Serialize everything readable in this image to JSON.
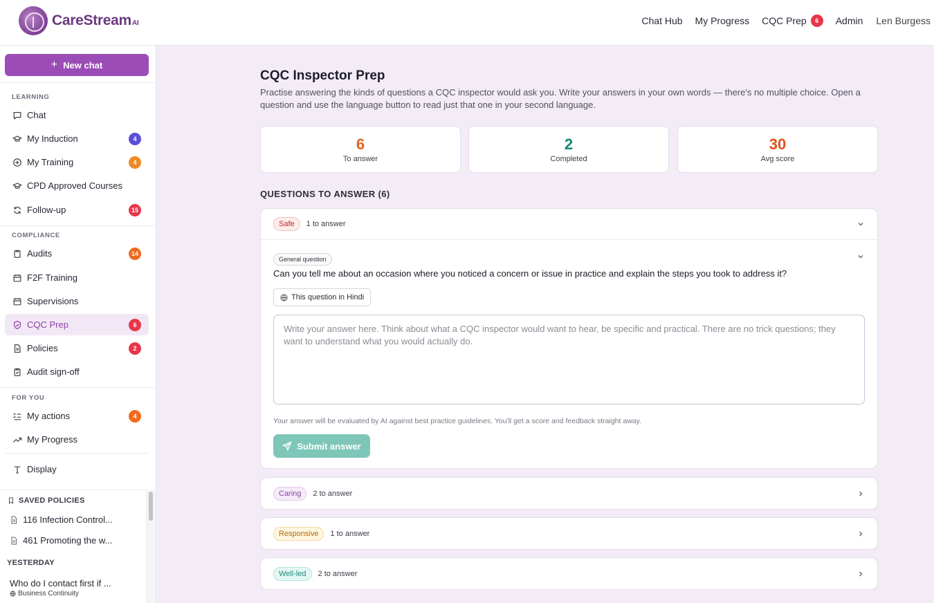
{
  "app": {
    "brand": "CareStream",
    "brand_suffix": "AI"
  },
  "topnav": {
    "items": [
      {
        "label": "Chat Hub"
      },
      {
        "label": "My Progress"
      },
      {
        "label": "CQC Prep",
        "badge": "6"
      },
      {
        "label": "Admin"
      }
    ],
    "user": "Len Burgess"
  },
  "sidebar": {
    "new_chat_label": "New chat",
    "sections": {
      "learning": "LEARNING",
      "compliance": "COMPLIANCE",
      "for_you": "FOR YOU"
    },
    "items": [
      {
        "label": "Chat",
        "icon": "chat-icon"
      },
      {
        "label": "My Induction",
        "icon": "graduation-cap-icon",
        "badge": "4"
      },
      {
        "label": "My Training",
        "icon": "training-icon",
        "badge": "4"
      },
      {
        "label": "CPD Approved Courses",
        "icon": "graduation-cap-icon"
      },
      {
        "label": "Follow-up",
        "icon": "refresh-icon",
        "badge": "15"
      },
      {
        "label": "Audits",
        "icon": "clipboard-icon",
        "badge": "14"
      },
      {
        "label": "F2F Training",
        "icon": "calendar-icon"
      },
      {
        "label": "Supervisions",
        "icon": "calendar-icon"
      },
      {
        "label": "CQC Prep",
        "icon": "shield-check-icon",
        "badge": "6",
        "active": true
      },
      {
        "label": "Policies",
        "icon": "document-icon",
        "badge": "2"
      },
      {
        "label": "Audit sign-off",
        "icon": "clipboard-check-icon"
      },
      {
        "label": "My actions",
        "icon": "checklist-icon",
        "badge": "4"
      },
      {
        "label": "My Progress",
        "icon": "trending-up-icon"
      },
      {
        "label": "Display",
        "icon": "text-type-icon"
      }
    ],
    "saved_label": "SAVED POLICIES",
    "saved": [
      {
        "label": "116 Infection Control..."
      },
      {
        "label": "461 Promoting the w..."
      }
    ],
    "yesterday_label": "YESTERDAY",
    "history": [
      {
        "title": "Who do I contact first if ...",
        "sub": "Business Continuity"
      }
    ]
  },
  "main": {
    "title": "CQC Inspector Prep",
    "description": "Practise answering the kinds of questions a CQC inspector would ask you. Write your answers in your own words — there's no multiple choice. Open a question and use the language button to read just that one in your second language.",
    "stats": [
      {
        "value": "6",
        "label": "To answer",
        "color": "#e0631b"
      },
      {
        "value": "2",
        "label": "Completed",
        "color": "#118a74"
      },
      {
        "value": "30",
        "label": "Avg score",
        "color": "#e0521b"
      }
    ],
    "questions_heading": "QUESTIONS TO ANSWER (6)",
    "categories": [
      {
        "name": "Safe",
        "count": "1 to answer",
        "expanded": true
      },
      {
        "name": "Caring",
        "count": "2 to answer"
      },
      {
        "name": "Responsive",
        "count": "1 to answer"
      },
      {
        "name": "Well-led",
        "count": "2 to answer"
      }
    ],
    "open_question": {
      "tag": "General question",
      "text": "Can you tell me about an occasion where you noticed a concern or issue in practice and explain the steps you took to address it?",
      "language_button": "This question in Hindi",
      "answer_placeholder": "Write your answer here. Think about what a CQC inspector would want to hear, be specific and practical. There are no trick questions; they want to understand what you would actually do.",
      "evaluation_note": "Your answer will be evaluated by AI against best practice guidelines. You'll get a score and feedback straight away.",
      "submit_label": "Submit answer"
    }
  }
}
